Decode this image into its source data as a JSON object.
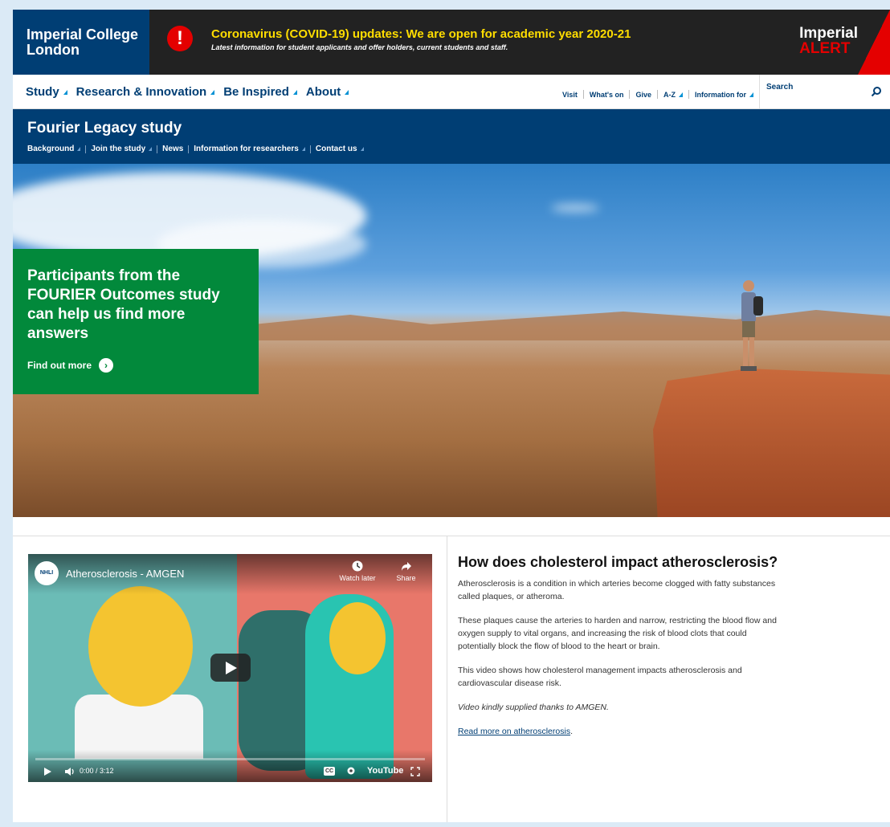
{
  "brand": {
    "line1": "Imperial College",
    "line2": "London"
  },
  "alert": {
    "icon": "exclamation-icon",
    "title": "Coronavirus (COVID-19) updates: We are open for academic year 2020-21",
    "subtitle": "Latest information for student applicants and offer holders, current students and staff.",
    "badge_line1": "Imperial",
    "badge_line2": "ALERT",
    "accent_color": "#e40000",
    "title_color": "#ffdd00"
  },
  "main_nav": {
    "items": [
      "Study",
      "Research & Innovation",
      "Be Inspired",
      "About"
    ],
    "utility": [
      "Visit",
      "What's on",
      "Give",
      "A-Z",
      "Information for"
    ],
    "search_placeholder": "Search"
  },
  "site": {
    "title": "Fourier Legacy study",
    "subnav": [
      "Background",
      "Join the study",
      "News",
      "Information for researchers",
      "Contact us"
    ]
  },
  "hero": {
    "title": "Participants from the FOURIER Outcomes study can help us find more answers",
    "link": "Find out more",
    "card_color": "#02893b"
  },
  "video": {
    "channel_logo": "NHLI",
    "title": "Atherosclerosis - AMGEN",
    "watch_later": "Watch later",
    "share": "Share",
    "time": "0:00 / 3:12",
    "cc": "CC",
    "brand": "YouTube"
  },
  "article": {
    "title": "How does cholesterol impact atherosclerosis?",
    "p1": "Atherosclerosis is a condition in which arteries become clogged with fatty substances called plaques, or atheroma.",
    "p2": "These plaques cause the arteries to harden and narrow, restricting the blood flow and oxygen supply to vital organs, and increasing the risk of blood clots that could potentially block the flow of blood to the heart or brain.",
    "p3": "This video shows how cholesterol management impacts atherosclerosis and cardiovascular disease risk.",
    "p4": "Video kindly supplied thanks to AMGEN.",
    "link": "Read more on atherosclerosis",
    "link_suffix": "."
  },
  "colors": {
    "navy": "#003e74",
    "nav_accent": "#0091d4"
  }
}
